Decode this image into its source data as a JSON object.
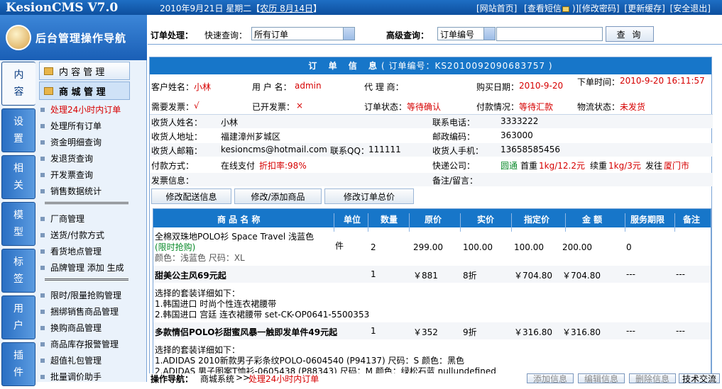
{
  "header": {
    "app_title": "KesionCMS V7.0",
    "date_text": "2010年9月21日 星期二【",
    "lunar": "农历 8月14日",
    "date_close": "】",
    "links": [
      "[网站首页]",
      "[查看短信",
      ")",
      "][修改密码]",
      "[更新缓存]",
      "[安全退出]"
    ],
    "unread_icon": "mail-icon"
  },
  "sidebar": {
    "title": "后台管理操作导航",
    "tabs": [
      "内\n容",
      "设\n置",
      "相\n关",
      "模\n型",
      "标\n签",
      "用\n户",
      "插\n件"
    ],
    "section_headers": [
      "内 容 管 理",
      "商 城 管 理"
    ],
    "items": [
      {
        "label": "处理24小时内订单",
        "red": true
      },
      {
        "label": "处理所有订单"
      },
      {
        "label": "资金明细查询"
      },
      {
        "label": "发退货查询"
      },
      {
        "label": "开发票查询"
      },
      {
        "label": "销售数据统计"
      },
      {
        "sep": true
      },
      {
        "label": "厂商管理"
      },
      {
        "label": "送货/付款方式"
      },
      {
        "label": "看货地点管理"
      },
      {
        "label": "品牌管理  添加  生成"
      },
      {
        "sep": true
      },
      {
        "label": "限时/限量抢购管理"
      },
      {
        "label": "捆绑销售商品管理"
      },
      {
        "label": "换购商品管理"
      },
      {
        "label": "商品库存报警管理"
      },
      {
        "label": "超值礼包管理"
      },
      {
        "label": "批量调价助手"
      }
    ]
  },
  "query": {
    "label": "订单处理：",
    "quick_label": "快速查询：",
    "quick_value": "所有订单",
    "adv_label": "高级查询：",
    "adv_value": "订单编号",
    "search_value": "",
    "search_button": "查 询"
  },
  "order": {
    "title": "订 单 信 息",
    "order_no_text": "( 订单编号：KS2010092090683757 )",
    "row1": {
      "customer_label": "客户姓名：",
      "customer": "小林",
      "user_label": "用 户 名：",
      "user": "admin",
      "agent_label": "代 理 商：",
      "buy_date_label": "购买日期：",
      "buy_date": "2010-9-20",
      "order_time_label": "下单时间：",
      "order_time": "2010-9-20 16:11:57"
    },
    "row2": {
      "invoice_label": "需要发票：",
      "invoice": "√",
      "issued_label": "已开发票：",
      "issued": "×",
      "status_label": "订单状态：",
      "status": "等待确认",
      "pay_label": "付款情况：",
      "pay": "等待汇款",
      "ship_label": "物流状态：",
      "ship": "未发货"
    },
    "receiver_name_label": "收货人姓名：",
    "receiver_name": "小林",
    "phone_label": "联系电话：",
    "phone": "3333222",
    "address_label": "收货人地址：",
    "address": "福建漳州芗城区",
    "zip_label": "邮政编码：",
    "zip": "363000",
    "email_label": "收货人邮箱：",
    "email": "kesioncms@hotmail.com",
    "qq_label": "联系QQ：",
    "qq": "111111",
    "mobile_label": "收货人手机：",
    "mobile": "13658585456",
    "paytype_label": "付款方式：",
    "paytype": "在线支付",
    "discount": "折扣率:98%",
    "express_label": "快递公司：",
    "express": "圆通",
    "first_label": "首重",
    "first": "1kg/12.2元",
    "cont_label": "续重",
    "cont": "1kg/3元",
    "send_label": "发往",
    "send": "厦门市",
    "invoice_info_label": "发票信息：",
    "remark_label": "备注/留言：",
    "buttons": [
      "修改配送信息",
      "修改/添加商品",
      "修改订单总价"
    ]
  },
  "goods": {
    "headers": [
      "商 品 名 称",
      "单位",
      "数量",
      "原价",
      "实价",
      "指定价",
      "金 额",
      "服务期限",
      "备注"
    ],
    "items": [
      {
        "name": "全棉双珠地POLO衫 Space Travel 浅蓝色",
        "promo": "(限时抢购)",
        "spec": "颜色：浅蓝色 尺码：XL",
        "unit": "件",
        "qty": "2",
        "orig": "299.00",
        "real": "100.00",
        "fixed": "100.00",
        "amount": "200.00",
        "term": "0",
        "note": ""
      },
      {
        "name": "甜美公主风69元起",
        "unit": "",
        "qty": "1",
        "orig": "￥881",
        "real": "8折",
        "fixed": "￥704.80",
        "amount": "￥704.80",
        "term": "---",
        "note": "---",
        "detail": [
          "选择的套装详细如下：",
          "1.韩国进口 时尚个性连衣裙腰带",
          "2.韩国进口 宫廷 连衣裙腰带 set-CK-OP0641-5500353"
        ]
      },
      {
        "name": "多款情侣POLO衫甜蜜风暴一触即发单件49元起",
        "unit": "",
        "qty": "1",
        "orig": "￥352",
        "real": "9折",
        "fixed": "￥316.80",
        "amount": "￥316.80",
        "term": "---",
        "note": "---",
        "detail": [
          "选择的套装详细如下：",
          "1.ADIDAS 2010新款男子彩条纹POLO-0604540 (P94137) 尺码：S 颜色：黑色",
          "2.ADIDAS 男子图案T恤衫-0605438 (P88343) 尺码：M 颜色：绿松石蓝 nullundefined"
        ]
      }
    ]
  },
  "footer": {
    "nav_label": "操作导航：",
    "nav_1": "商城系统",
    ">": " >> ",
    "nav_2": "处理24小时内订单",
    "buttons": [
      "添加信息",
      "编辑信息",
      "删除信息",
      "技术交流"
    ]
  }
}
